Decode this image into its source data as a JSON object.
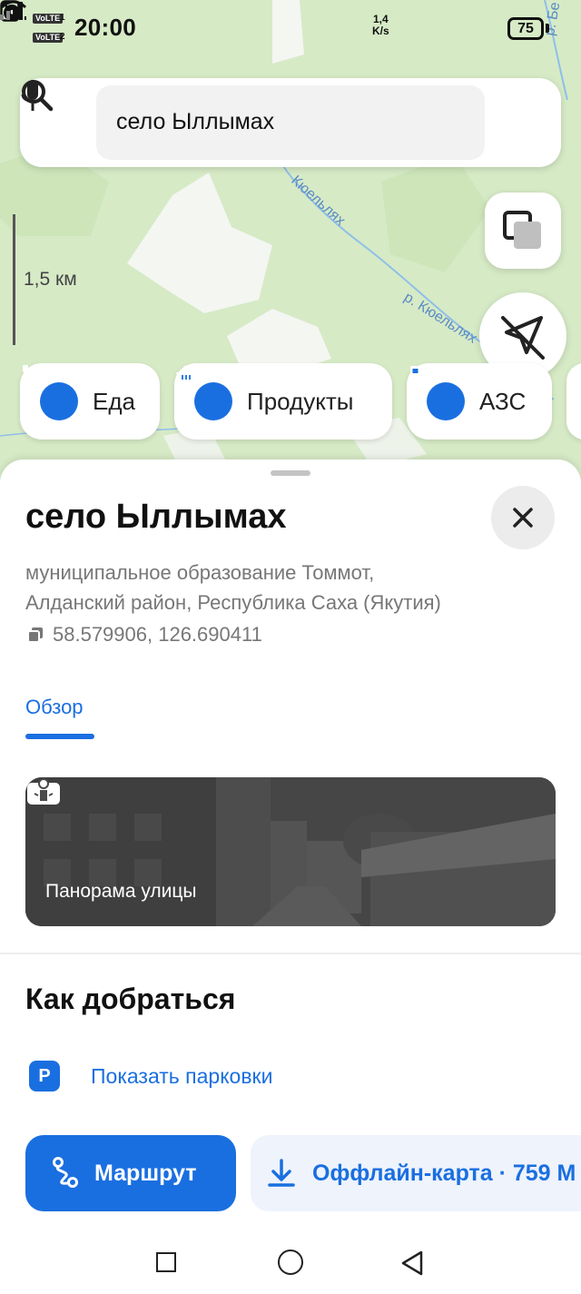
{
  "status_bar": {
    "time": "20:00",
    "volte_1": "VoLTE",
    "volte_1_num": "1",
    "volte_2": "VoLTE",
    "volte_2_num": "2",
    "net_speed_value": "1,4",
    "net_speed_unit": "K/s",
    "battery": "75"
  },
  "search": {
    "query": "село Ыллымах"
  },
  "map": {
    "scale_label": "1,5 км",
    "river_labels": [
      "Кюельлях",
      "р. Кюельлях",
      "р. Бе"
    ]
  },
  "chips": [
    {
      "label": "Еда",
      "icon": "fork-knife-icon"
    },
    {
      "label": "Продукты",
      "icon": "basket-icon"
    },
    {
      "label": "АЗС",
      "icon": "fuel-pump-icon"
    }
  ],
  "place": {
    "title": "село Ыллымах",
    "address_line1": "муниципальное образование Томмот,",
    "address_line2": "Алданский район, Республика Саха (Якутия)",
    "coordinates": "58.579906, 126.690411"
  },
  "tabs": {
    "overview": "Обзор"
  },
  "panorama": {
    "label": "Панорама улицы"
  },
  "directions": {
    "heading": "Как добраться",
    "parking_icon_letter": "P",
    "parking_label": "Показать парковки",
    "route_label": "Маршрут",
    "offline_label": "Оффлайн-карта · 759 М"
  },
  "colors": {
    "accent": "#1a6fe0",
    "map_green": "#d8ebc8",
    "river": "#8fbfe8"
  }
}
